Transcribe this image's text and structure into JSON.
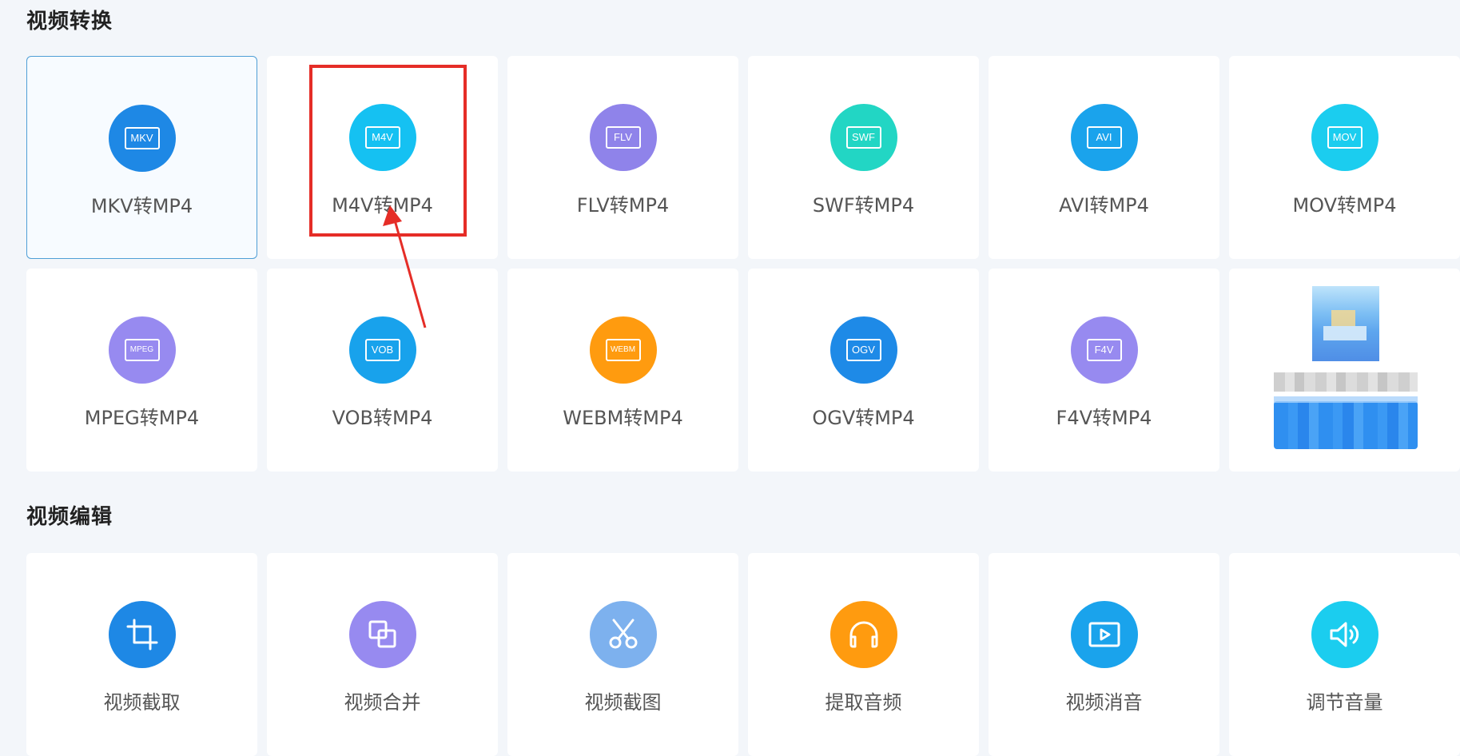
{
  "sections": {
    "convert_title": "视频转换",
    "edit_title": "视频编辑"
  },
  "convert_items": [
    {
      "badge": "MKV",
      "label": "MKV转MP4",
      "color": "#1e88e5"
    },
    {
      "badge": "M4V",
      "label": "M4V转MP4",
      "color": "#15c1f2"
    },
    {
      "badge": "FLV",
      "label": "FLV转MP4",
      "color": "#8f83ea"
    },
    {
      "badge": "SWF",
      "label": "SWF转MP4",
      "color": "#22d6c4"
    },
    {
      "badge": "AVI",
      "label": "AVI转MP4",
      "color": "#1aa3ec"
    },
    {
      "badge": "MOV",
      "label": "MOV转MP4",
      "color": "#1bcdef"
    },
    {
      "badge": "MPEG",
      "label": "MPEG转MP4",
      "color": "#978af0"
    },
    {
      "badge": "VOB",
      "label": "VOB转MP4",
      "color": "#18a2ec"
    },
    {
      "badge": "WEBM",
      "label": "WEBM转MP4",
      "color": "#ff9b0f"
    },
    {
      "badge": "OGV",
      "label": "OGV转MP4",
      "color": "#1e8ae7"
    },
    {
      "badge": "F4V",
      "label": "F4V转MP4",
      "color": "#978af0"
    }
  ],
  "edit_items": [
    {
      "icon": "crop-icon",
      "label": "视频截取",
      "color": "#1e88e5"
    },
    {
      "icon": "merge-icon",
      "label": "视频合并",
      "color": "#978af0"
    },
    {
      "icon": "scissors-icon",
      "label": "视频截图",
      "color": "#7db1ee"
    },
    {
      "icon": "headphones-icon",
      "label": "提取音频",
      "color": "#ff9b0f"
    },
    {
      "icon": "play-screen-icon",
      "label": "视频消音",
      "color": "#1aa3ec"
    },
    {
      "icon": "speaker-icon",
      "label": "调节音量",
      "color": "#1bcdef"
    }
  ],
  "annotation": {
    "highlight_color": "#e52d27"
  }
}
